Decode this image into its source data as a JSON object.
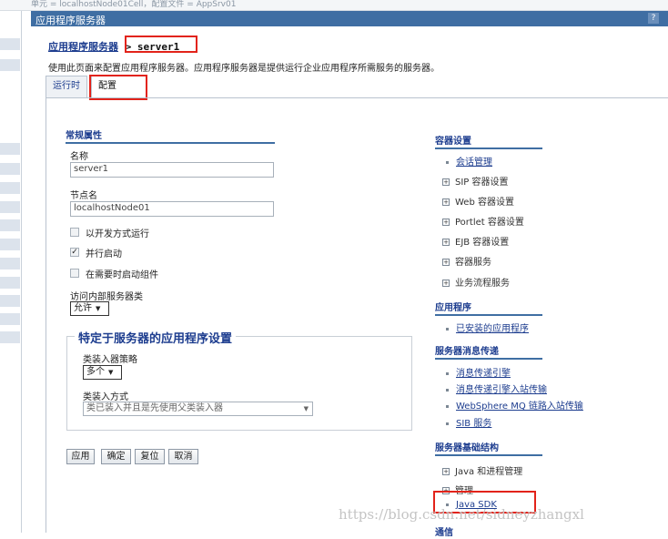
{
  "topbar": {
    "text": "单元 = localhostNode01Cell，配置文件 = AppSrv01"
  },
  "title_bar": {
    "title": "应用程序服务器",
    "help": "?"
  },
  "breadcrumb": {
    "parent": "应用程序服务器",
    "separator": ">",
    "current": "server1"
  },
  "description": "使用此页面来配置应用程序服务器。应用程序服务器是提供运行企业应用程序所需服务的服务器。",
  "tabs": [
    {
      "label": "运行时",
      "selected": false
    },
    {
      "label": "配置",
      "selected": true
    }
  ],
  "general": {
    "section_title": "常规属性",
    "name_label": "名称",
    "name_value": "server1",
    "node_label": "节点名",
    "node_value": "localhostNode01",
    "checkboxes": [
      {
        "label": "以开发方式运行",
        "checked": false
      },
      {
        "label": "并行启动",
        "checked": true
      },
      {
        "label": "在需要时启动组件",
        "checked": false
      }
    ],
    "internal_access_label": "访问内部服务器类",
    "internal_access_value": "允许"
  },
  "app_settings": {
    "title": "特定于服务器的应用程序设置",
    "classloader_policy_label": "类装入器策略",
    "classloader_policy_value": "多个",
    "classloading_mode_label": "类装入方式",
    "classloading_mode_value": "类已装入并且是先使用父类装入器"
  },
  "buttons": {
    "apply": "应用",
    "ok": "确定",
    "reset": "复位",
    "cancel": "取消"
  },
  "right": {
    "container_settings": {
      "title": "容器设置",
      "items": [
        {
          "label": "会话管理",
          "kind": "link"
        },
        {
          "label": "SIP 容器设置",
          "kind": "expand"
        },
        {
          "label": "Web 容器设置",
          "kind": "expand"
        },
        {
          "label": "Portlet 容器设置",
          "kind": "expand"
        },
        {
          "label": "EJB 容器设置",
          "kind": "expand"
        },
        {
          "label": "容器服务",
          "kind": "expand"
        },
        {
          "label": "业务流程服务",
          "kind": "expand"
        }
      ]
    },
    "applications": {
      "title": "应用程序",
      "items": [
        {
          "label": "已安装的应用程序",
          "kind": "link"
        }
      ]
    },
    "messaging": {
      "title": "服务器消息传递",
      "items": [
        {
          "label": "消息传递引擎",
          "kind": "link"
        },
        {
          "label": "消息传递引擎入站传输",
          "kind": "link"
        },
        {
          "label": "WebSphere MQ 链路入站传输",
          "kind": "link"
        },
        {
          "label": "SIB 服务",
          "kind": "link"
        }
      ]
    },
    "infrastructure": {
      "title": "服务器基础结构",
      "items": [
        {
          "label": "Java 和进程管理",
          "kind": "expand"
        },
        {
          "label": "管理",
          "kind": "expand"
        },
        {
          "label": "Java SDK",
          "kind": "link"
        }
      ]
    },
    "next_section_title": "通信"
  },
  "watermark": "https://blog.csdn.net/sidneyzhangxl",
  "colors": {
    "title_bar": "#3f6ea3",
    "link": "#1d3d8f",
    "highlight": "#e2231a"
  }
}
